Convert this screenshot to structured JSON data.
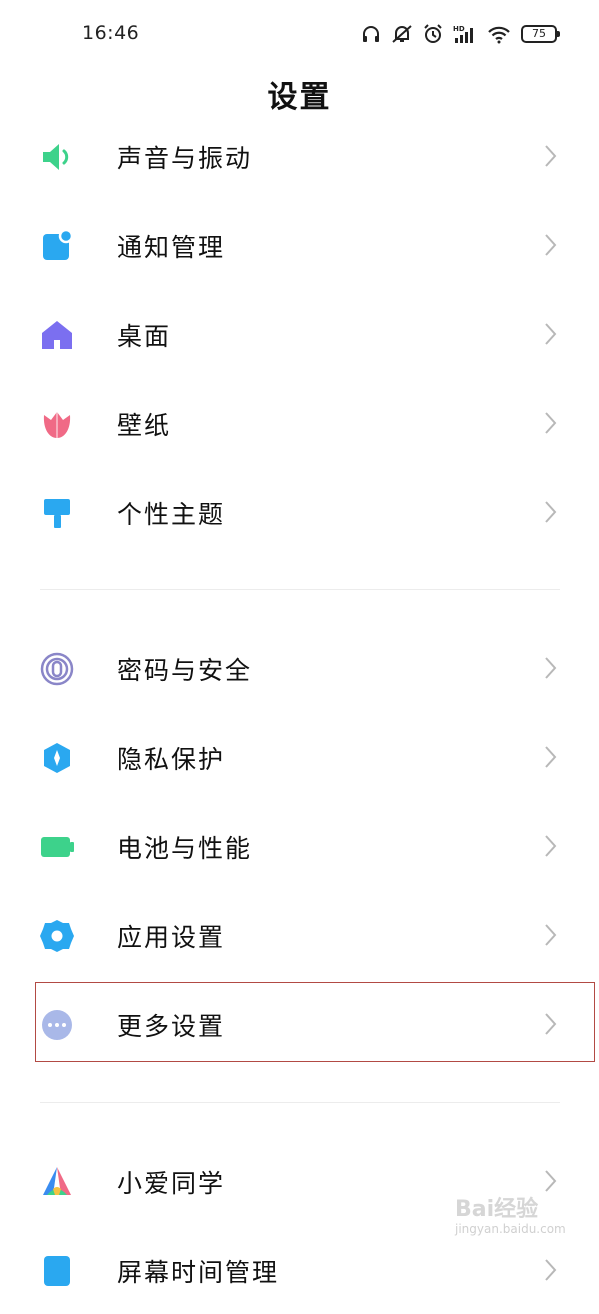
{
  "status_bar": {
    "time": "16:46",
    "battery": "75",
    "icons": [
      "headphones-icon",
      "bell-muted-icon",
      "alarm-icon",
      "hd-signal-icon",
      "wifi-icon",
      "battery-icon"
    ]
  },
  "header": {
    "title": "设置"
  },
  "groups": [
    {
      "items": [
        {
          "label": "声音与振动",
          "icon": "speaker-icon",
          "color": "#3dd28b"
        },
        {
          "label": "通知管理",
          "icon": "notification-icon",
          "color": "#2aa8f0"
        },
        {
          "label": "桌面",
          "icon": "home-icon",
          "color": "#7b6ff0"
        },
        {
          "label": "壁纸",
          "icon": "tulip-icon",
          "color": "#f06a86"
        },
        {
          "label": "个性主题",
          "icon": "paint-brush-icon",
          "color": "#2aa8f0"
        }
      ]
    },
    {
      "items": [
        {
          "label": "密码与安全",
          "icon": "fingerprint-icon",
          "color": "#8a86c8"
        },
        {
          "label": "隐私保护",
          "icon": "privacy-shield-icon",
          "color": "#2aa8f0"
        },
        {
          "label": "电池与性能",
          "icon": "battery-performance-icon",
          "color": "#3dd28b"
        },
        {
          "label": "应用设置",
          "icon": "gear-icon",
          "color": "#2aa8f0"
        },
        {
          "label": "更多设置",
          "icon": "more-dots-icon",
          "color": "#a9b8e8"
        }
      ]
    },
    {
      "items": [
        {
          "label": "小爱同学",
          "icon": "xiaoai-icon",
          "color": "#3a8cf0"
        },
        {
          "label": "屏幕时间管理",
          "icon": "screen-time-icon",
          "color": "#2aa8f0"
        }
      ]
    }
  ],
  "watermark": {
    "brand": "Bai经验",
    "url": "jingyan.baidu.com"
  }
}
